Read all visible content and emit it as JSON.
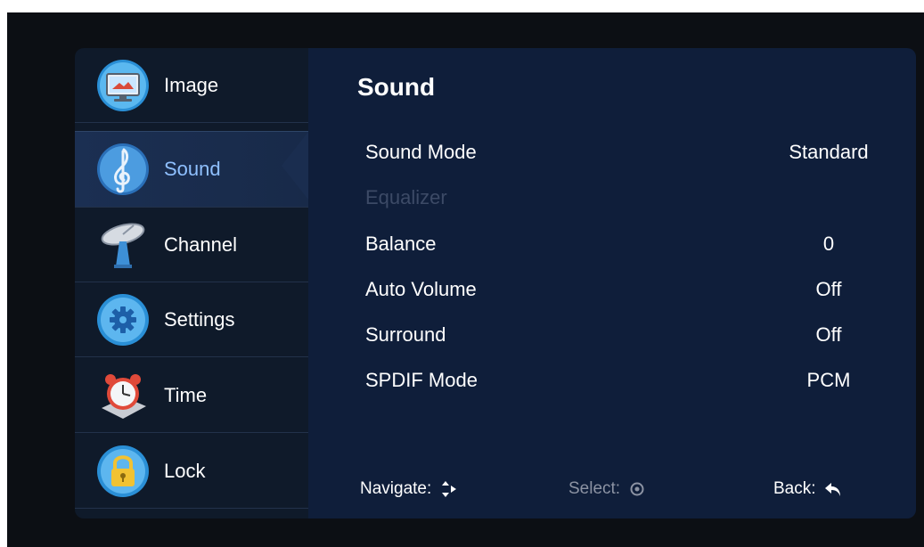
{
  "sidebar": {
    "items": [
      {
        "label": "Image",
        "icon": "monitor-icon"
      },
      {
        "label": "Sound",
        "icon": "treble-clef-icon",
        "selected": true
      },
      {
        "label": "Channel",
        "icon": "satellite-dish-icon"
      },
      {
        "label": "Settings",
        "icon": "gear-icon"
      },
      {
        "label": "Time",
        "icon": "alarm-clock-icon"
      },
      {
        "label": "Lock",
        "icon": "padlock-icon"
      }
    ]
  },
  "panel": {
    "title": "Sound",
    "rows": [
      {
        "label": "Sound Mode",
        "value": "Standard",
        "enabled": true
      },
      {
        "label": "Equalizer",
        "value": "",
        "enabled": false
      },
      {
        "label": "Balance",
        "value": "0",
        "enabled": true
      },
      {
        "label": "Auto Volume",
        "value": "Off",
        "enabled": true
      },
      {
        "label": "Surround",
        "value": "Off",
        "enabled": true
      },
      {
        "label": "SPDIF Mode",
        "value": "PCM",
        "enabled": true
      }
    ]
  },
  "footer": {
    "navigate_label": "Navigate:",
    "select_label": "Select:",
    "back_label": "Back:"
  },
  "colors": {
    "selected_text": "#8fc0ff",
    "panel_bg": "#0f1e3a",
    "sidebar_bg": "#0f1a2a",
    "disabled_text": "#3c4a66"
  }
}
